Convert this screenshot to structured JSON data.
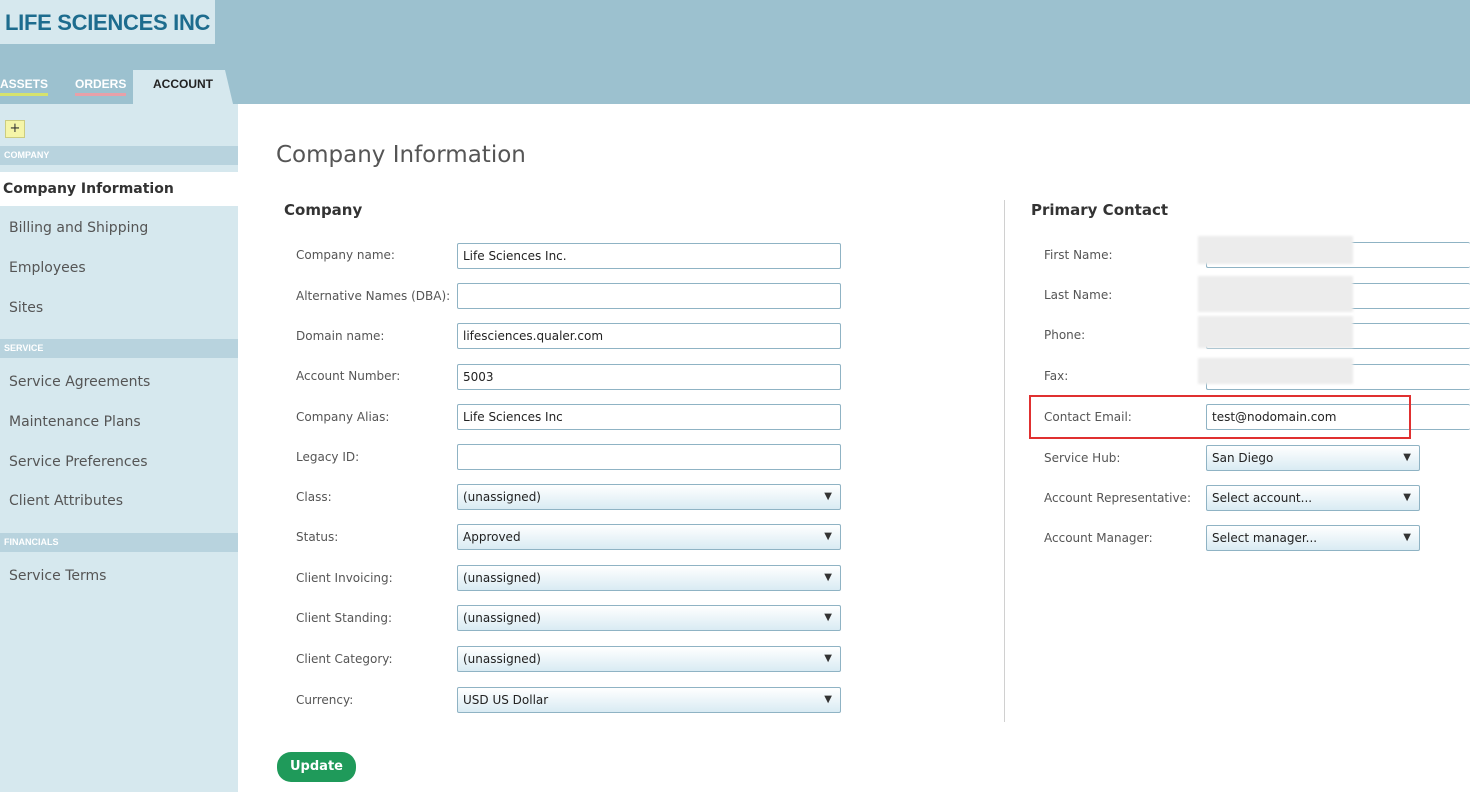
{
  "app": {
    "logo": "LIFE SCIENCES INC"
  },
  "tabs": [
    {
      "label": "ASSETS"
    },
    {
      "label": "ORDERS"
    },
    {
      "label": "ACCOUNT"
    }
  ],
  "sidebar": {
    "add_label": "+",
    "sections": [
      {
        "label": "COMPANY"
      },
      {
        "label": "SERVICE"
      },
      {
        "label": "FINANCIALS"
      }
    ],
    "items": [
      {
        "label": "Company Information"
      },
      {
        "label": "Billing and Shipping"
      },
      {
        "label": "Employees"
      },
      {
        "label": "Sites"
      },
      {
        "label": "Service Agreements"
      },
      {
        "label": "Maintenance Plans"
      },
      {
        "label": "Service Preferences"
      },
      {
        "label": "Client Attributes"
      },
      {
        "label": "Service Terms"
      }
    ]
  },
  "main": {
    "title": "Company Information",
    "company": {
      "heading": "Company",
      "fields": [
        {
          "label": "Company name:",
          "value": "Life Sciences Inc."
        },
        {
          "label": "Alternative Names (DBA):",
          "value": ""
        },
        {
          "label": "Domain name:",
          "value": "lifesciences.qualer.com"
        },
        {
          "label": "Account Number:",
          "value": "5003"
        },
        {
          "label": "Company Alias:",
          "value": "Life Sciences Inc"
        },
        {
          "label": "Legacy ID:",
          "value": ""
        },
        {
          "label": "Class:",
          "value": "(unassigned)"
        },
        {
          "label": "Status:",
          "value": "Approved"
        },
        {
          "label": "Client Invoicing:",
          "value": "(unassigned)"
        },
        {
          "label": "Client Standing:",
          "value": "(unassigned)"
        },
        {
          "label": "Client Category:",
          "value": "(unassigned)"
        },
        {
          "label": "Currency:",
          "value": "USD US Dollar"
        }
      ]
    },
    "contact": {
      "heading": "Primary Contact",
      "fields": [
        {
          "label": "First Name:",
          "value": ""
        },
        {
          "label": "Last Name:",
          "value": ""
        },
        {
          "label": "Phone:",
          "value": ""
        },
        {
          "label": "Fax:",
          "value": ""
        },
        {
          "label": "Contact Email:",
          "value": "test@nodomain.com"
        },
        {
          "label": "Service Hub:",
          "value": "San Diego"
        },
        {
          "label": "Account Representative:",
          "value": "Select account..."
        },
        {
          "label": "Account Manager:",
          "value": "Select manager..."
        }
      ]
    },
    "update_label": "Update"
  },
  "colors": {
    "banner": "#9cc1cf",
    "sidebar": "#d6e8ee",
    "logo_text": "#1d6c8e",
    "update_button": "#1f9a5a",
    "highlight": "#e03030"
  }
}
